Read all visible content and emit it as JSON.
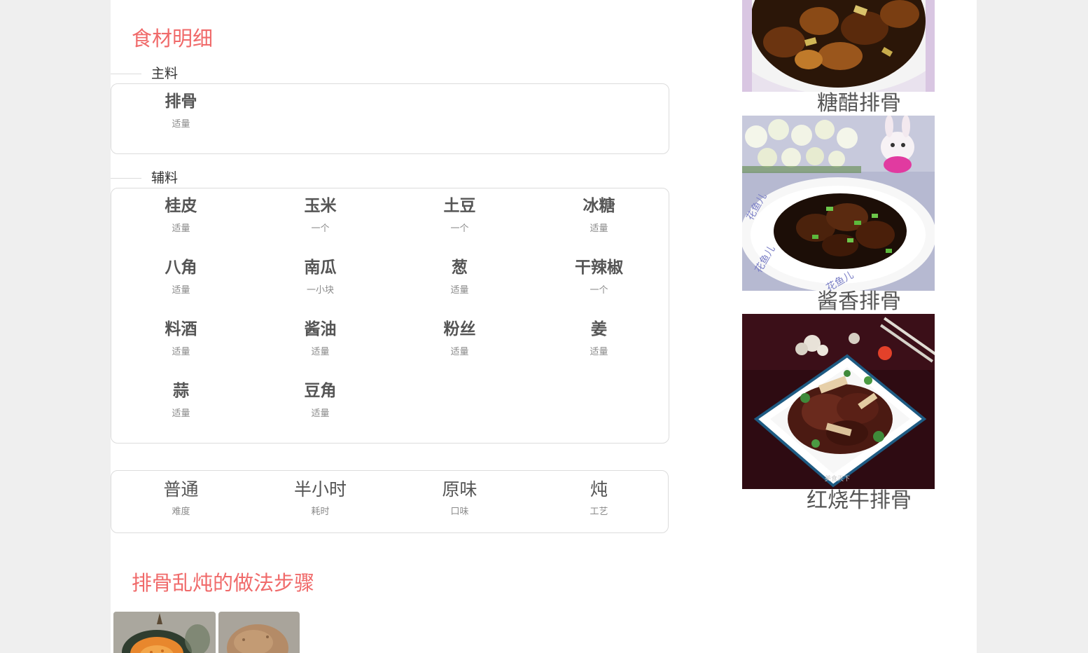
{
  "ingredients_title": "食材明细",
  "main": {
    "label": "主料",
    "items": [
      {
        "name": "排骨",
        "amount": "适量"
      }
    ]
  },
  "aux": {
    "label": "辅料",
    "items": [
      {
        "name": "桂皮",
        "amount": "适量"
      },
      {
        "name": "玉米",
        "amount": "一个"
      },
      {
        "name": "土豆",
        "amount": "一个"
      },
      {
        "name": "冰糖",
        "amount": "适量"
      },
      {
        "name": "八角",
        "amount": "适量"
      },
      {
        "name": "南瓜",
        "amount": "一小块"
      },
      {
        "name": "葱",
        "amount": "适量"
      },
      {
        "name": "干辣椒",
        "amount": "一个"
      },
      {
        "name": "料酒",
        "amount": "适量"
      },
      {
        "name": "酱油",
        "amount": "适量"
      },
      {
        "name": "粉丝",
        "amount": "适量"
      },
      {
        "name": "姜",
        "amount": "适量"
      },
      {
        "name": "蒜",
        "amount": "适量"
      },
      {
        "name": "豆角",
        "amount": "适量"
      }
    ]
  },
  "info": [
    {
      "value": "普通",
      "label": "难度"
    },
    {
      "value": "半小时",
      "label": "耗时"
    },
    {
      "value": "原味",
      "label": "口味"
    },
    {
      "value": "炖",
      "label": "工艺"
    }
  ],
  "steps_title": "排骨乱炖的做法步骤",
  "recommendations": [
    {
      "title": "糖醋排骨"
    },
    {
      "title": "酱香排骨"
    },
    {
      "title": "红烧牛排骨"
    }
  ],
  "watermarks": [
    "花鱼儿",
    "美食天下"
  ]
}
